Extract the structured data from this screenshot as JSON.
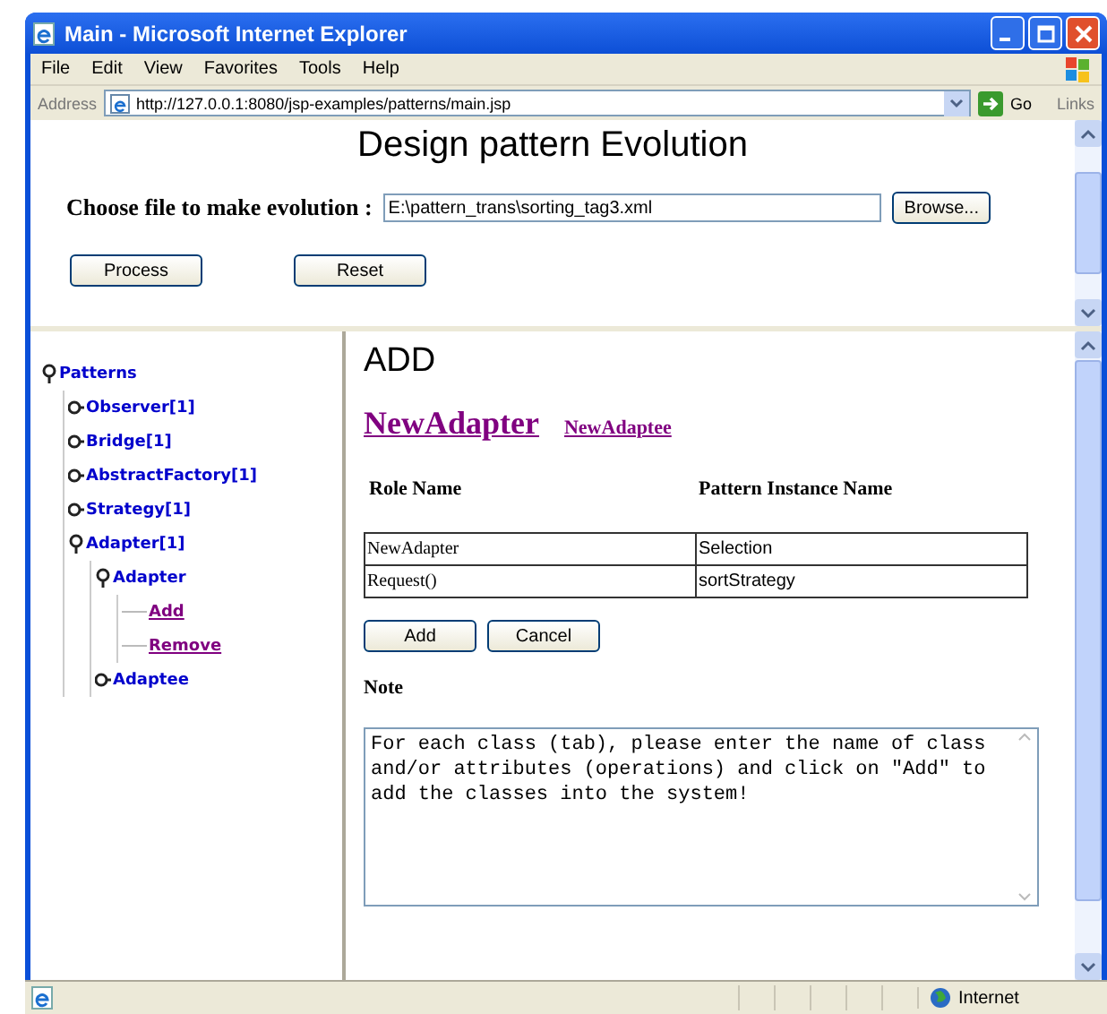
{
  "window": {
    "title": "Main - Microsoft Internet Explorer"
  },
  "menu": [
    "File",
    "Edit",
    "View",
    "Favorites",
    "Tools",
    "Help"
  ],
  "address_bar": {
    "label": "Address",
    "url": "http://127.0.0.1:8080/jsp-examples/patterns/main.jsp",
    "go": "Go",
    "links": "Links"
  },
  "top_frame": {
    "heading": "Design pattern Evolution",
    "file_label": "Choose file to make evolution :",
    "file_value": "E:\\pattern_trans\\sorting_tag3.xml",
    "browse": "Browse...",
    "buttons": [
      "Process",
      "Reset"
    ]
  },
  "tree": [
    {
      "label": "Patterns",
      "kind": "folder",
      "expanded": true,
      "children": [
        {
          "label": "Observer[1]",
          "kind": "folder",
          "expanded": false
        },
        {
          "label": "Bridge[1]",
          "kind": "folder",
          "expanded": false
        },
        {
          "label": "AbstractFactory[1]",
          "kind": "folder",
          "expanded": false
        },
        {
          "label": "Strategy[1]",
          "kind": "folder",
          "expanded": false
        },
        {
          "label": "Adapter[1]",
          "kind": "folder",
          "expanded": true,
          "children": [
            {
              "label": "Adapter",
              "kind": "folder",
              "expanded": true,
              "children": [
                {
                  "label": "Add",
                  "kind": "link"
                },
                {
                  "label": "Remove",
                  "kind": "link"
                }
              ]
            },
            {
              "label": "Adaptee",
              "kind": "folder",
              "expanded": false
            }
          ]
        }
      ]
    }
  ],
  "content": {
    "heading": "ADD",
    "tabs": [
      {
        "label": "NewAdapter",
        "selected": true
      },
      {
        "label": "NewAdaptee",
        "selected": false
      }
    ],
    "columns": [
      "Role Name",
      "Pattern Instance Name"
    ],
    "rows": [
      [
        "NewAdapter",
        "Selection"
      ],
      [
        "Request()",
        "sortStrategy"
      ]
    ],
    "buttons": [
      "Add",
      "Cancel"
    ],
    "note_label": "Note",
    "note_text": "For each class (tab), please enter the name of class and/or attributes (operations) and click on \"Add\" to add the classes into the system!"
  },
  "status_bar": {
    "zone": "Internet"
  }
}
